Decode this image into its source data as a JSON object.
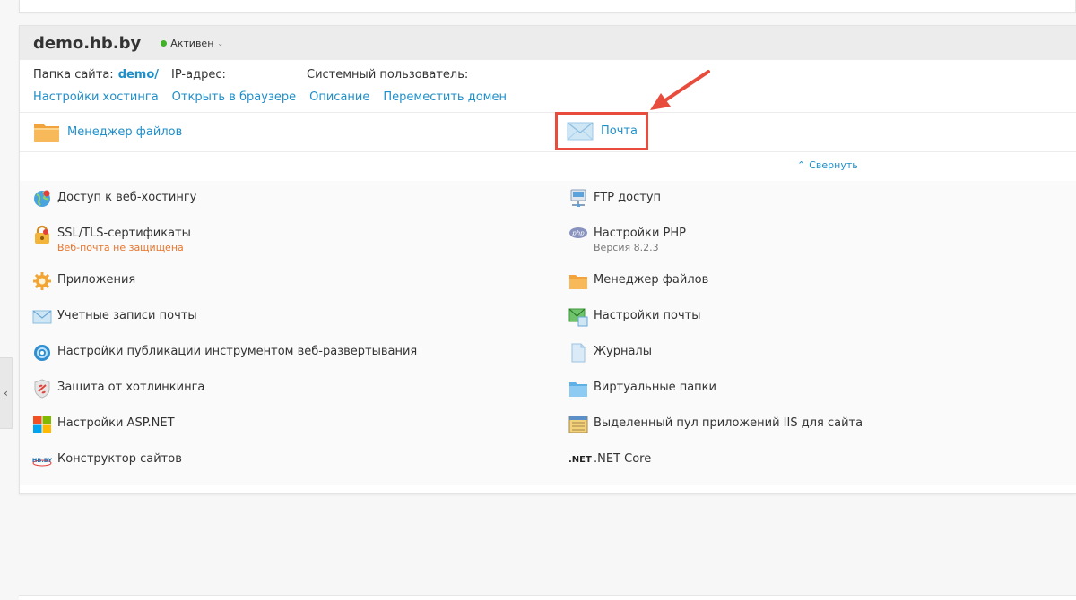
{
  "domain": {
    "name": "demo.hb.by",
    "status": "Активен"
  },
  "info": {
    "folder_label": "Папка сайта:",
    "folder_value": "demo/",
    "ip_label": "IP-адрес:",
    "sysuser_label": "Системный пользователь:"
  },
  "links": [
    "Настройки хостинга",
    "Открыть в браузере",
    "Описание",
    "Переместить домен"
  ],
  "quick": {
    "file_manager": "Менеджер файлов",
    "mail": "Почта"
  },
  "collapse": "Свернуть",
  "tools_left": [
    {
      "label": "Доступ к веб-хостингу",
      "icon": "globe-icon"
    },
    {
      "label": "SSL/TLS-сертификаты",
      "sub": "Веб-почта не защищена",
      "icon": "lock-icon"
    },
    {
      "label": "Приложения",
      "icon": "gear-icon"
    },
    {
      "label": "Учетные записи почты",
      "icon": "envelope-icon"
    },
    {
      "label": "Настройки публикации инструментом веб-развертывания",
      "icon": "web-deploy-icon"
    },
    {
      "label": "Защита от хотлинкинга",
      "icon": "shield-icon"
    },
    {
      "label": "Настройки ASP.NET",
      "icon": "windows-icon"
    },
    {
      "label": "Конструктор сайтов",
      "icon": "hb-logo-icon"
    }
  ],
  "tools_right": [
    {
      "label": "FTP доступ",
      "icon": "ftp-icon"
    },
    {
      "label": "Настройки PHP",
      "sub": "Версия 8.2.3",
      "icon": "php-icon"
    },
    {
      "label": "Менеджер файлов",
      "icon": "folder-icon"
    },
    {
      "label": "Настройки почты",
      "icon": "mail-settings-icon"
    },
    {
      "label": "Журналы",
      "icon": "log-icon"
    },
    {
      "label": "Виртуальные папки",
      "icon": "virtual-folder-icon"
    },
    {
      "label": "Выделенный пул приложений IIS для сайта",
      "icon": "iis-pool-icon"
    },
    {
      "label": ".NET Core",
      "icon": "dotnet-icon"
    }
  ],
  "icons_text": {
    "dotnet": ".NET",
    "php": "php",
    "hb": "HB.BY"
  },
  "colors": {
    "link": "#1f8fc9",
    "status_active": "#43b02a",
    "warning": "#e8742a",
    "highlight": "#e84c3d"
  }
}
